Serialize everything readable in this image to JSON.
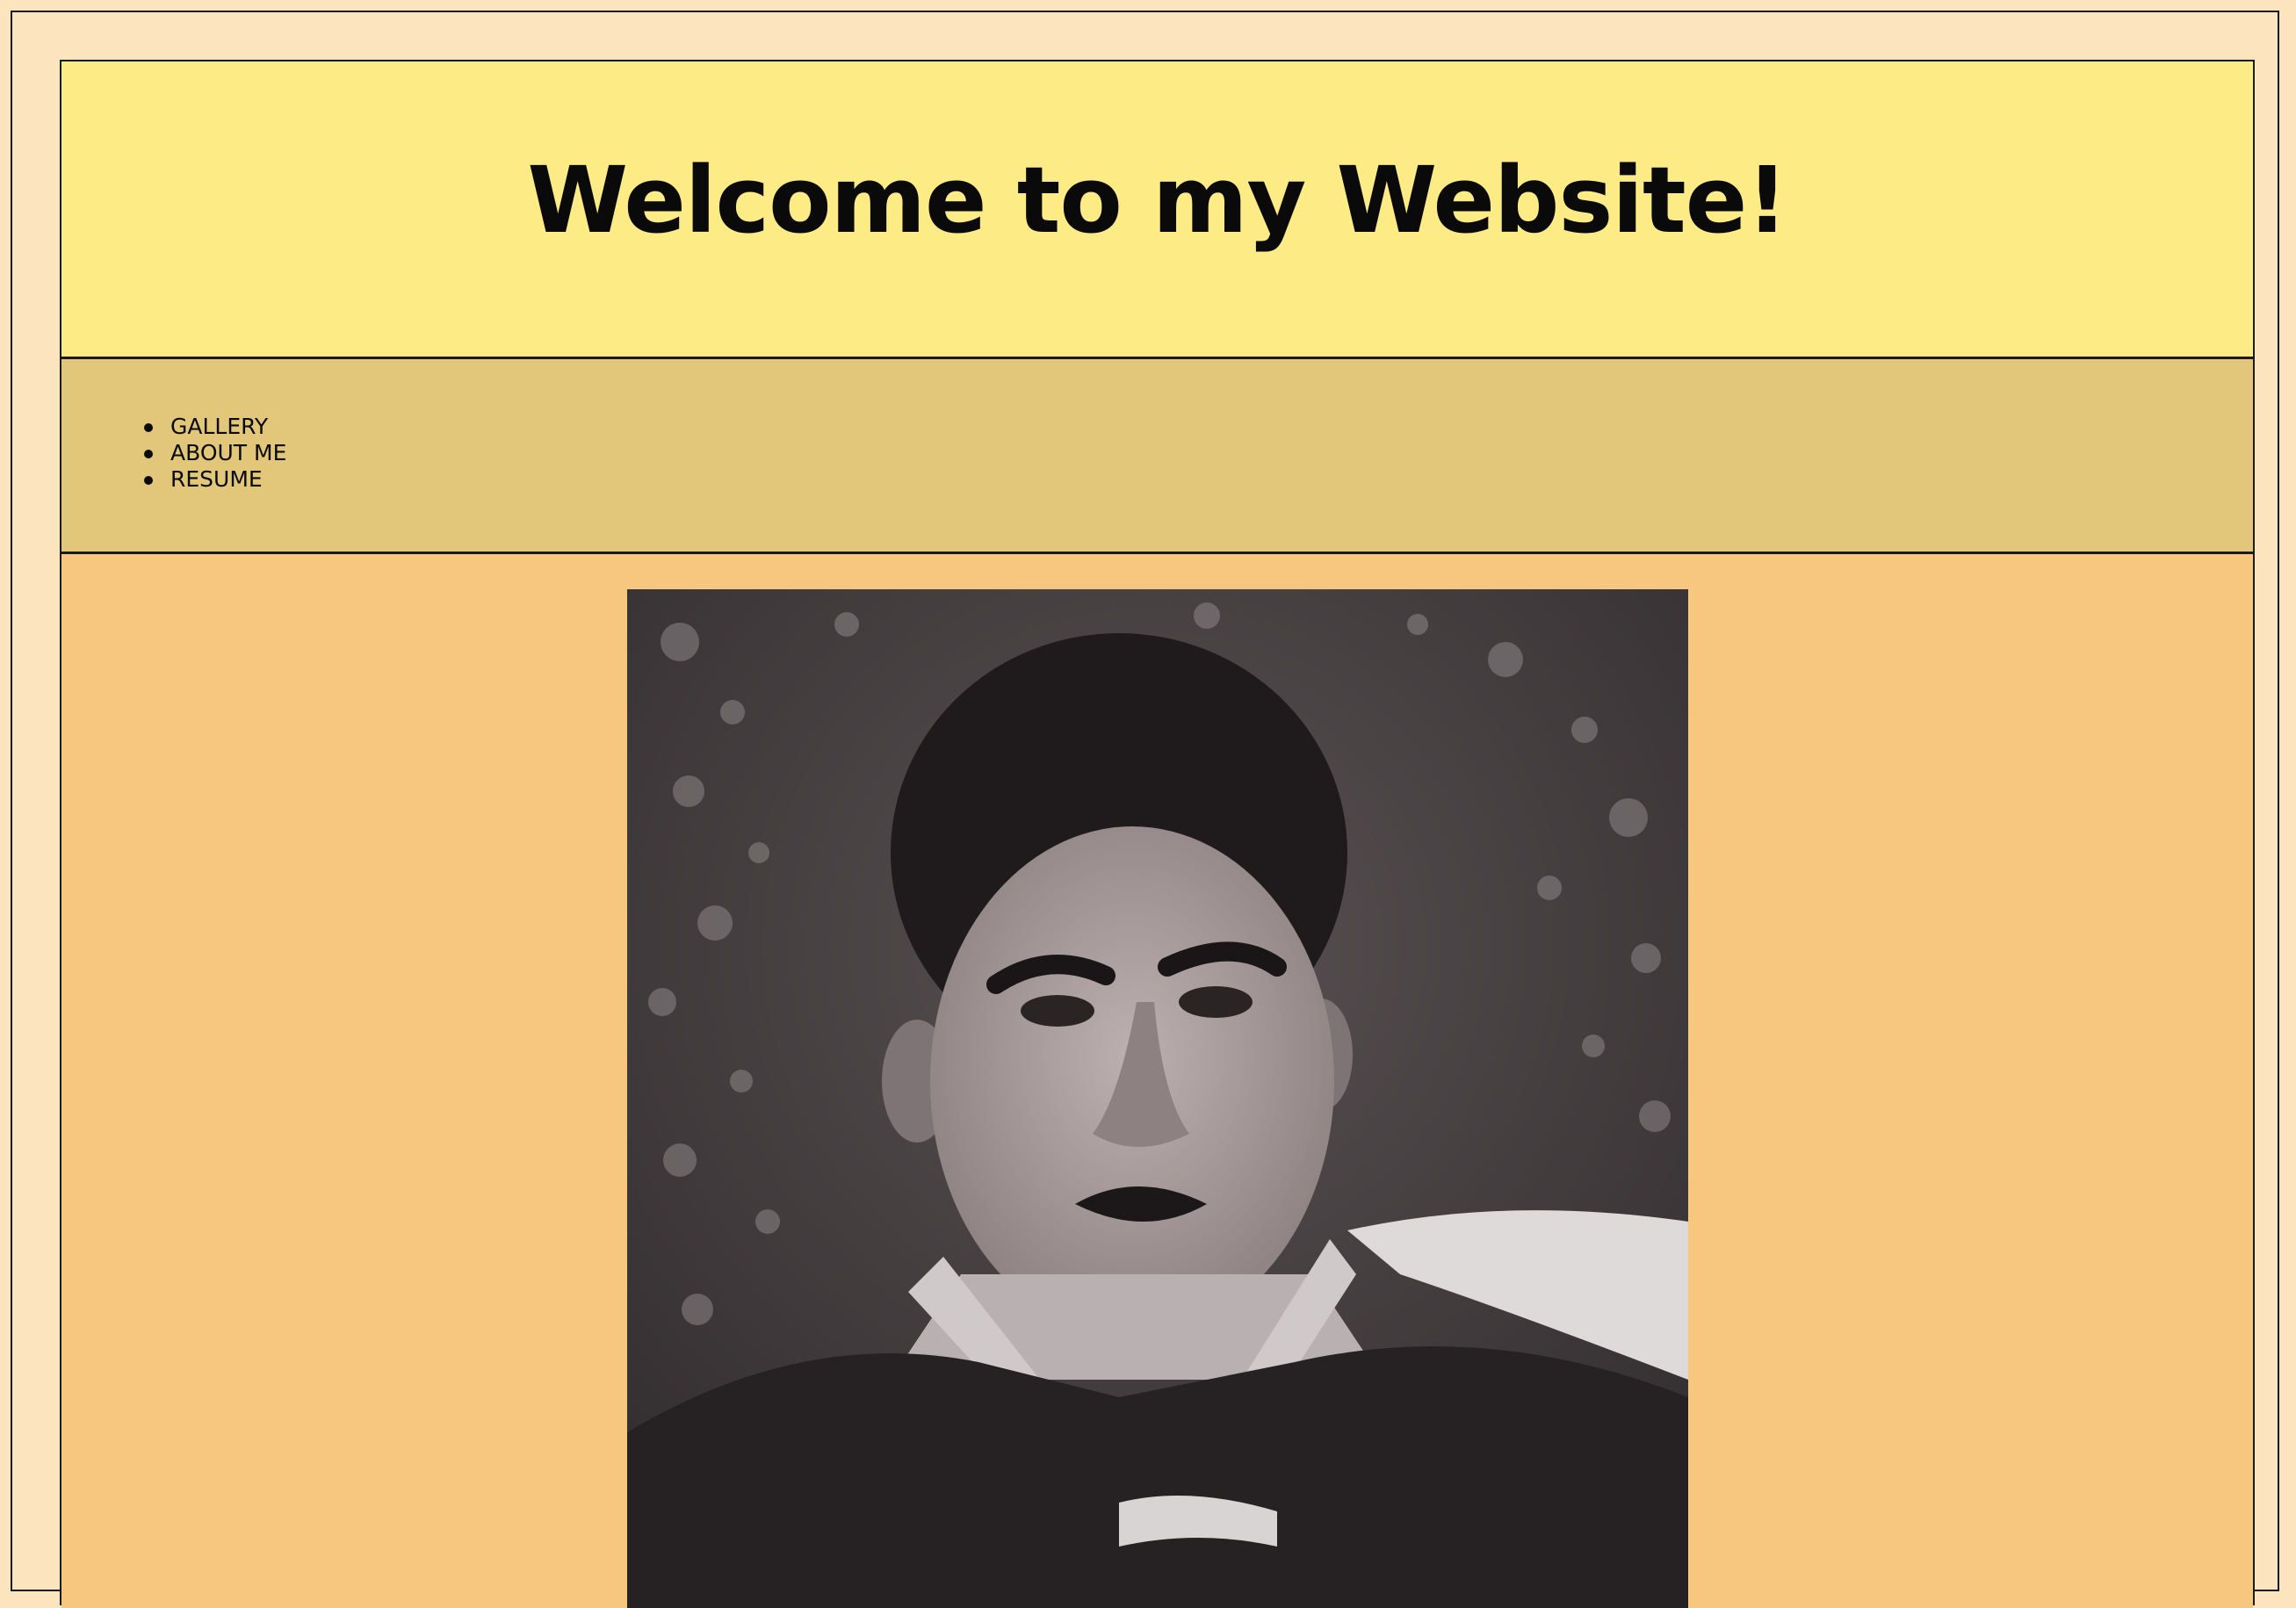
{
  "header": {
    "title": "Welcome to my Website!"
  },
  "nav": {
    "items": [
      {
        "label": "GALLERY"
      },
      {
        "label": "ABOUT ME"
      },
      {
        "label": "RESUME"
      }
    ]
  },
  "main": {
    "photo": {
      "icon": "portrait-photo-icon"
    }
  },
  "colors": {
    "page_background": "#fce4bf",
    "header_background": "#fdeb86",
    "nav_background": "#e2c679",
    "content_background": "#f7c67f",
    "border": "#1a1a1a"
  }
}
